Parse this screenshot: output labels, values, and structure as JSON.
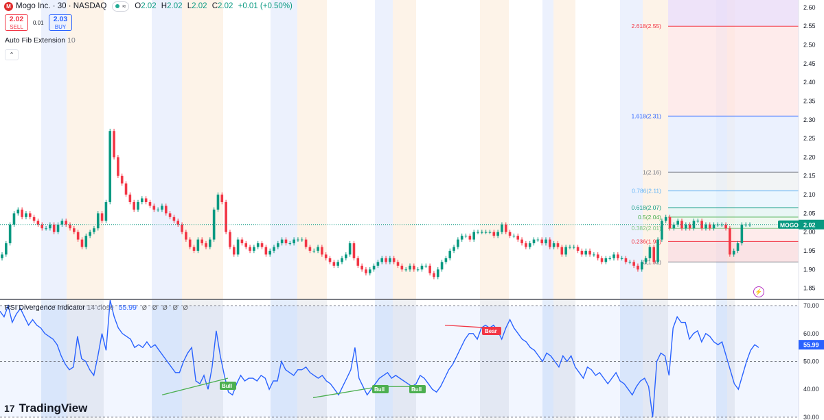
{
  "header": {
    "logo_letter": "M",
    "symbol": "Mogo Inc. · 30 · NASDAQ",
    "pill": "≈",
    "ohlc": [
      {
        "k": "O",
        "v": "2.02"
      },
      {
        "k": "H",
        "v": "2.02"
      },
      {
        "k": "L",
        "v": "2.02"
      },
      {
        "k": "C",
        "v": "2.02"
      }
    ],
    "change": "+0.01 (+0.50%)",
    "sell_price": "2.02",
    "sell_label": "SELL",
    "spread": "0.01",
    "buy_price": "2.03",
    "buy_label": "BUY",
    "indicator_name": "Auto Fib Extension",
    "indicator_param": "10",
    "collapse_icon": "^"
  },
  "rsi_header": {
    "name": "RSI Divergence Indicator",
    "params": "14 close",
    "value": "55.99",
    "icons": [
      "Ø",
      "Ø",
      "Ø",
      "Ø",
      "Ø"
    ]
  },
  "branding": {
    "name": "TradingView",
    "mark": "17"
  },
  "colors": {
    "up": "#089981",
    "down": "#f23645",
    "rsi": "#2962ff",
    "blue_band": "#e9effd",
    "orange_band": "#fdf1e4",
    "gray_band": "#e3e5ea"
  },
  "chart_data": [
    {
      "type": "candlestick",
      "ticker": "MOGO",
      "last_price": "2.02",
      "y_ticks": [
        "2.60",
        "2.55",
        "2.50",
        "2.45",
        "2.40",
        "2.35",
        "2.30",
        "2.25",
        "2.20",
        "2.15",
        "2.10",
        "2.05",
        "2.00",
        "1.95",
        "1.90",
        "1.85"
      ],
      "ylim": [
        1.82,
        2.62
      ],
      "close": [
        1.94,
        1.97,
        2.02,
        2.05,
        2.06,
        2.04,
        2.05,
        2.04,
        2.03,
        2.02,
        2.01,
        2.01,
        2.02,
        2.0,
        2.02,
        2.03,
        2.02,
        2.01,
        2.0,
        1.98,
        1.96,
        1.99,
        2.0,
        2.01,
        2.05,
        2.03,
        2.08,
        2.27,
        2.2,
        2.15,
        2.13,
        2.1,
        2.08,
        2.06,
        2.08,
        2.09,
        2.08,
        2.07,
        2.06,
        2.06,
        2.07,
        2.05,
        2.04,
        2.03,
        2.02,
        2.0,
        1.98,
        1.96,
        1.95,
        1.98,
        1.97,
        1.96,
        1.98,
        2.06,
        2.1,
        2.08,
        2.0,
        1.96,
        1.94,
        1.98,
        1.97,
        1.96,
        1.95,
        1.96,
        1.97,
        1.96,
        1.94,
        1.95,
        1.96,
        1.97,
        1.98,
        1.97,
        1.97,
        1.98,
        1.98,
        1.98,
        1.96,
        1.95,
        1.95,
        1.96,
        1.94,
        1.93,
        1.92,
        1.91,
        1.92,
        1.93,
        1.94,
        1.97,
        1.93,
        1.91,
        1.9,
        1.89,
        1.9,
        1.91,
        1.92,
        1.93,
        1.92,
        1.93,
        1.92,
        1.91,
        1.9,
        1.9,
        1.91,
        1.9,
        1.9,
        1.91,
        1.91,
        1.89,
        1.88,
        1.9,
        1.92,
        1.93,
        1.95,
        1.96,
        1.98,
        1.99,
        1.99,
        1.98,
        2.0,
        2.0,
        2.0,
        2.0,
        2.0,
        1.99,
        2.0,
        2.02,
        2.0,
        1.99,
        1.99,
        1.98,
        1.97,
        1.96,
        1.97,
        1.98,
        1.98,
        1.97,
        1.98,
        1.96,
        1.97,
        1.96,
        1.94,
        1.96,
        1.96,
        1.96,
        1.95,
        1.94,
        1.95,
        1.94,
        1.94,
        1.93,
        1.92,
        1.93,
        1.93,
        1.94,
        1.93,
        1.93,
        1.92,
        1.92,
        1.91,
        1.9,
        1.92,
        1.93,
        1.96,
        1.92,
        1.98,
        2.03,
        2.04,
        2.01,
        2.02,
        2.03,
        2.01,
        2.02,
        2.01,
        2.03,
        2.03,
        2.01,
        2.02,
        2.01,
        2.02,
        2.02,
        2.02,
        2.01,
        1.94,
        1.95,
        1.97,
        2.02,
        2.02,
        2.02
      ],
      "fib_levels": [
        {
          "label": "0(1.92)",
          "value": 1.92,
          "color": "#787b86"
        },
        {
          "label": "0.236(1.98)",
          "value": 1.975,
          "color": "#f23645"
        },
        {
          "label": "0.382(2.01)",
          "value": 2.01,
          "color": "#81c784"
        },
        {
          "label": "0.5(2.04)",
          "value": 2.04,
          "color": "#4caf50"
        },
        {
          "label": "0.618(2.07)",
          "value": 2.065,
          "color": "#089981"
        },
        {
          "label": "0.786(2.11)",
          "value": 2.11,
          "color": "#64b5f6"
        },
        {
          "label": "1(2.16)",
          "value": 2.16,
          "color": "#787b86"
        },
        {
          "label": "1.618(2.31)",
          "value": 2.31,
          "color": "#2962ff"
        },
        {
          "label": "2.618(2.55)",
          "value": 2.55,
          "color": "#f23645"
        }
      ]
    },
    {
      "type": "line",
      "name": "RSI",
      "y_ticks": [
        "70.00",
        "60.00",
        "50.00",
        "40.00",
        "30.00"
      ],
      "ylim": [
        29,
        72
      ],
      "values": [
        68,
        66,
        70,
        64,
        67,
        69,
        66,
        63,
        65,
        63,
        62,
        60,
        59,
        58,
        56,
        52,
        49,
        47,
        48,
        59,
        51,
        50,
        47,
        45,
        52,
        60,
        54,
        72,
        66,
        62,
        60,
        59,
        58,
        55,
        56,
        55,
        57,
        55,
        56,
        54,
        52,
        50,
        48,
        46,
        46,
        50,
        53,
        55,
        43,
        42,
        45,
        40,
        48,
        61,
        52,
        45,
        39,
        38,
        42,
        45,
        43,
        44,
        44,
        43,
        45,
        44,
        40,
        43,
        43,
        50,
        47,
        46,
        45,
        47,
        47,
        48,
        46,
        45,
        44,
        45,
        43,
        42,
        40,
        38,
        41,
        44,
        47,
        55,
        44,
        41,
        38,
        40,
        42,
        44,
        45,
        46,
        44,
        45,
        44,
        43,
        42,
        41,
        42,
        45,
        44,
        42,
        40,
        39,
        41,
        44,
        47,
        49,
        52,
        55,
        58,
        60,
        60,
        58,
        62,
        63,
        62,
        63,
        61,
        58,
        62,
        65,
        62,
        60,
        58,
        57,
        55,
        54,
        52,
        50,
        53,
        52,
        50,
        48,
        52,
        50,
        52,
        48,
        46,
        44,
        48,
        47,
        45,
        46,
        44,
        42,
        44,
        46,
        43,
        42,
        40,
        38,
        41,
        43,
        44,
        41,
        30,
        50,
        53,
        52,
        45,
        62,
        66,
        64,
        64,
        58,
        60,
        61,
        57,
        60,
        59,
        57,
        56,
        57,
        52,
        47,
        42,
        40,
        45,
        50,
        54,
        56,
        55
      ]
    }
  ],
  "pane_labels": {
    "price_badge_ticker": "MOGO",
    "price_badge_value": "2.02",
    "rsi_badge_value": "55.99",
    "bull_labels": [
      "Bull",
      "Bull",
      "Bull"
    ],
    "bear_label": "Bear"
  }
}
